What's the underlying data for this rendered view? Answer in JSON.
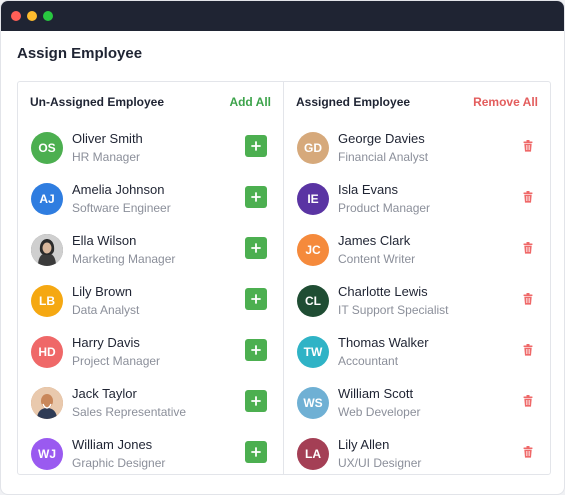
{
  "page_title": "Assign Employee",
  "unassigned": {
    "title": "Un-Assigned Employee",
    "action_label": "Add All",
    "items": [
      {
        "initials": "OS",
        "name": "Oliver Smith",
        "role": "HR Manager",
        "color": "#4caf50"
      },
      {
        "initials": "AJ",
        "name": "Amelia Johnson",
        "role": "Software Engineer",
        "color": "#2f7de0"
      },
      {
        "initials": "",
        "name": "Ella Wilson",
        "role": "Marketing Manager",
        "color": "#6a6a6a",
        "photo": "photo-icon"
      },
      {
        "initials": "LB",
        "name": "Lily Brown",
        "role": "Data Analyst",
        "color": "#f5a812"
      },
      {
        "initials": "HD",
        "name": "Harry Davis",
        "role": "Project Manager",
        "color": "#ef6868"
      },
      {
        "initials": "",
        "name": "Jack Taylor",
        "role": "Sales Representative",
        "color": "#c88a5b",
        "photo": "photo-icon"
      },
      {
        "initials": "WJ",
        "name": "William Jones",
        "role": "Graphic Designer",
        "color": "#9a5af0"
      }
    ]
  },
  "assigned": {
    "title": "Assigned Employee",
    "action_label": "Remove All",
    "items": [
      {
        "initials": "GD",
        "name": "George Davies",
        "role": "Financial Analyst",
        "color": "#d6a97b"
      },
      {
        "initials": "IE",
        "name": "Isla Evans",
        "role": "Product Manager",
        "color": "#5a34a3"
      },
      {
        "initials": "JC",
        "name": "James Clark",
        "role": "Content Writer",
        "color": "#f58a3c"
      },
      {
        "initials": "CL",
        "name": "Charlotte Lewis",
        "role": "IT Support Specialist",
        "color": "#1f4d33"
      },
      {
        "initials": "TW",
        "name": "Thomas Walker",
        "role": "Accountant",
        "color": "#2fb3c6"
      },
      {
        "initials": "WS",
        "name": "William Scott",
        "role": "Web Developer",
        "color": "#6fb0d4"
      },
      {
        "initials": "LA",
        "name": "Lily Allen",
        "role": "UX/UI Designer",
        "color": "#a43f55"
      }
    ]
  },
  "colors": {
    "add_button": "#4caf50",
    "add_all_text": "#3da34b",
    "remove_text": "#e35d5d",
    "titlebar": "#1f2433"
  }
}
